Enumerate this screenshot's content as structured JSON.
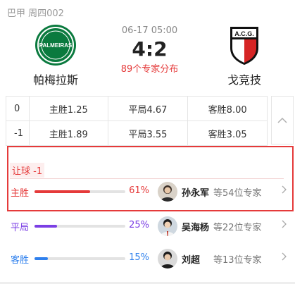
{
  "league": "巴甲 周四002",
  "match": {
    "home": {
      "name": "帕梅拉斯",
      "logo_icon": "palmeiras-crest-icon",
      "logo_text": "PALMEIRAS"
    },
    "away": {
      "name": "戈竞技",
      "logo_icon": "acg-shield-icon",
      "logo_text": "A.C.G."
    },
    "time": "06-17 05:00",
    "score": "4:2",
    "expert_distribution": "89个专家分布"
  },
  "odds_rows": [
    {
      "handicap": "0",
      "home": "主胜1.25",
      "draw": "平局4.67",
      "away": "客胜8.00"
    },
    {
      "handicap": "-1",
      "home": "主胜1.89",
      "draw": "平局3.55",
      "away": "客胜3.05"
    }
  ],
  "collapse_icon": "chevron-up-icon",
  "handicap_tag": "让球 -1",
  "predictions": [
    {
      "label": "主胜",
      "percent": "61%",
      "value": 61,
      "color": "#e53a3a",
      "expert": "孙永军",
      "count": "等54位专家"
    },
    {
      "label": "平局",
      "percent": "25%",
      "value": 25,
      "color": "#7b3fe4",
      "expert": "吴海杨",
      "count": "等22位专家"
    },
    {
      "label": "客胜",
      "percent": "15%",
      "value": 15,
      "color": "#2f80ed",
      "expert": "刘超",
      "count": "等13位专家"
    }
  ],
  "colors": {
    "accent": "#e53a3a",
    "border": "#e5e5e5"
  }
}
